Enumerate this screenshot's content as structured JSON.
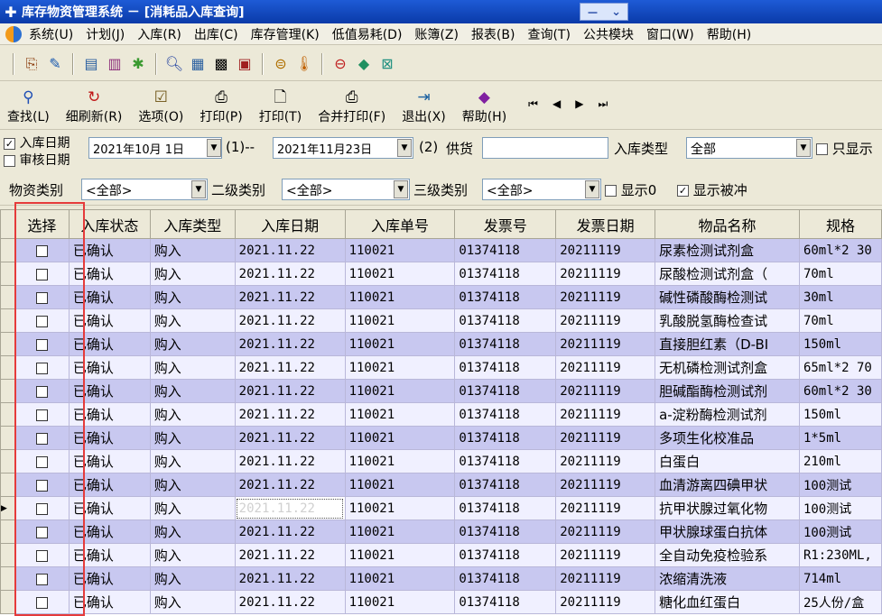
{
  "window": {
    "title": "库存物资管理系统 － [消耗品入库查询]",
    "controls": [
      "－",
      "⌄"
    ]
  },
  "menu": [
    "系统(U)",
    "计划(J)",
    "入库(R)",
    "出库(C)",
    "库存管理(K)",
    "低值易耗(D)",
    "账簿(Z)",
    "报表(B)",
    "查询(T)",
    "公共模块",
    "窗口(W)",
    "帮助(H)"
  ],
  "toolbar_buttons": [
    {
      "label": "查找(L)",
      "icon": "search-icon"
    },
    {
      "label": "细刷新(R)",
      "icon": "refresh-icon"
    },
    {
      "label": "选项(O)",
      "icon": "options-icon"
    },
    {
      "label": "打印(P)",
      "icon": "printer-icon"
    },
    {
      "label": "打印(T)",
      "icon": "print-preview-icon"
    },
    {
      "label": "合并打印(F)",
      "icon": "merge-print-icon"
    },
    {
      "label": "退出(X)",
      "icon": "exit-icon"
    },
    {
      "label": "帮助(H)",
      "icon": "help-icon"
    }
  ],
  "filters": {
    "date_mode": [
      {
        "label": "入库日期",
        "checked": true
      },
      {
        "label": "审核日期",
        "checked": false
      }
    ],
    "date_from": "2021年10月  1日",
    "range_sep_1": "(1)--",
    "date_to": "2021年11月23日",
    "range_sep_2": "(2)",
    "supplier_label": "供货",
    "supplier_value": "",
    "inbound_type_label": "入库类型",
    "inbound_type_value": "全部",
    "only_show_label": "只显示",
    "category_label": "物资类别",
    "category_value": "<全部>",
    "level2_label": "二级类别",
    "level2_value": "<全部>",
    "level3_label": "三级类别",
    "level3_value": "<全部>",
    "show_zero_label": "显示0",
    "show_zero_checked": false,
    "show_offset_label": "显示被冲",
    "show_offset_checked": true
  },
  "table": {
    "columns": [
      "选择",
      "入库状态",
      "入库类型",
      "入库日期",
      "入库单号",
      "发票号",
      "发票日期",
      "物品名称",
      "规格"
    ],
    "rows": [
      [
        "已确认",
        "购入",
        "2021.11.22",
        "110021",
        "01374118",
        "20211119",
        "尿素检测试剂盒",
        "60ml*2 30"
      ],
      [
        "已确认",
        "购入",
        "2021.11.22",
        "110021",
        "01374118",
        "20211119",
        "尿酸检测试剂盒（",
        "70ml"
      ],
      [
        "已确认",
        "购入",
        "2021.11.22",
        "110021",
        "01374118",
        "20211119",
        "碱性磷酸酶检测试",
        "30ml"
      ],
      [
        "已确认",
        "购入",
        "2021.11.22",
        "110021",
        "01374118",
        "20211119",
        "乳酸脱氢酶检查试",
        "70ml"
      ],
      [
        "已确认",
        "购入",
        "2021.11.22",
        "110021",
        "01374118",
        "20211119",
        "直接胆红素（D-BI",
        "150ml"
      ],
      [
        "已确认",
        "购入",
        "2021.11.22",
        "110021",
        "01374118",
        "20211119",
        "无机磷检测试剂盒",
        "65ml*2 70"
      ],
      [
        "已确认",
        "购入",
        "2021.11.22",
        "110021",
        "01374118",
        "20211119",
        "胆碱酯酶检测试剂",
        "60ml*2 30"
      ],
      [
        "已确认",
        "购入",
        "2021.11.22",
        "110021",
        "01374118",
        "20211119",
        "a-淀粉酶检测试剂",
        "150ml"
      ],
      [
        "已确认",
        "购入",
        "2021.11.22",
        "110021",
        "01374118",
        "20211119",
        "多项生化校准品",
        "1*5ml"
      ],
      [
        "已确认",
        "购入",
        "2021.11.22",
        "110021",
        "01374118",
        "20211119",
        "白蛋白",
        "210ml"
      ],
      [
        "已确认",
        "购入",
        "2021.11.22",
        "110021",
        "01374118",
        "20211119",
        "血清游离四碘甲状",
        "100测试"
      ],
      [
        "已确认",
        "购入",
        "2021.11.22",
        "110021",
        "01374118",
        "20211119",
        "抗甲状腺过氧化物",
        "100测试"
      ],
      [
        "已确认",
        "购入",
        "2021.11.22",
        "110021",
        "01374118",
        "20211119",
        "甲状腺球蛋白抗体",
        "100测试"
      ],
      [
        "已确认",
        "购入",
        "2021.11.22",
        "110021",
        "01374118",
        "20211119",
        "全自动免疫检验系",
        "R1:230ML,"
      ],
      [
        "已确认",
        "购入",
        "2021.11.22",
        "110021",
        "01374118",
        "20211119",
        "浓缩清洗液",
        "714ml"
      ],
      [
        "已确认",
        "购入",
        "2021.11.22",
        "110021",
        "01374118",
        "20211119",
        "糖化血红蛋白",
        "25人份/盒"
      ]
    ],
    "current_row_index": 11
  }
}
